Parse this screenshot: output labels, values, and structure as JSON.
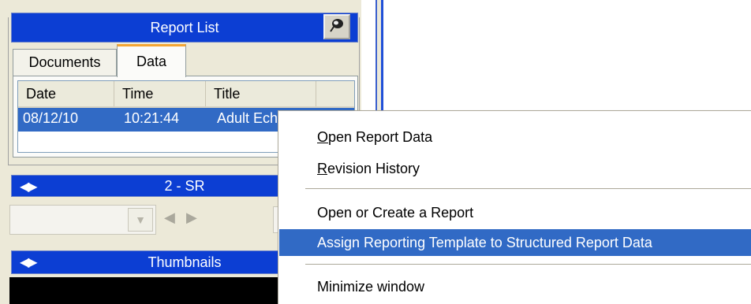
{
  "report_list": {
    "title": "Report List",
    "tabs": [
      {
        "label": "Documents",
        "active": false
      },
      {
        "label": "Data",
        "active": true
      }
    ],
    "columns": [
      "Date",
      "Time",
      "Title"
    ],
    "rows": [
      {
        "date": "08/12/10",
        "time": "10:21:44",
        "title": "Adult Ech",
        "selected": true
      }
    ]
  },
  "series_bar": {
    "title": "2 - SR"
  },
  "thumbnails_bar": {
    "title": "Thumbnails"
  },
  "context_menu": {
    "items": [
      {
        "label": "Open Report Data",
        "mnemonic": "O",
        "rest": "pen Report Data",
        "highlighted": false
      },
      {
        "label": "Revision History",
        "mnemonic": "R",
        "rest": "evision History",
        "highlighted": false
      },
      {
        "label": "Open or Create a Report",
        "highlighted": false
      },
      {
        "label": "Assign Reporting Template to Structured Report Data",
        "highlighted": true
      },
      {
        "label": "Minimize window",
        "highlighted": false
      }
    ]
  },
  "colors": {
    "title_bar": "#0c3ed3",
    "selection": "#316ac5",
    "panel": "#ece9d8",
    "tab_accent": "#f4a533"
  },
  "icons": [
    "pin-icon",
    "prev-arrow-icon",
    "next-arrow-icon",
    "dropdown-arrow-icon"
  ]
}
